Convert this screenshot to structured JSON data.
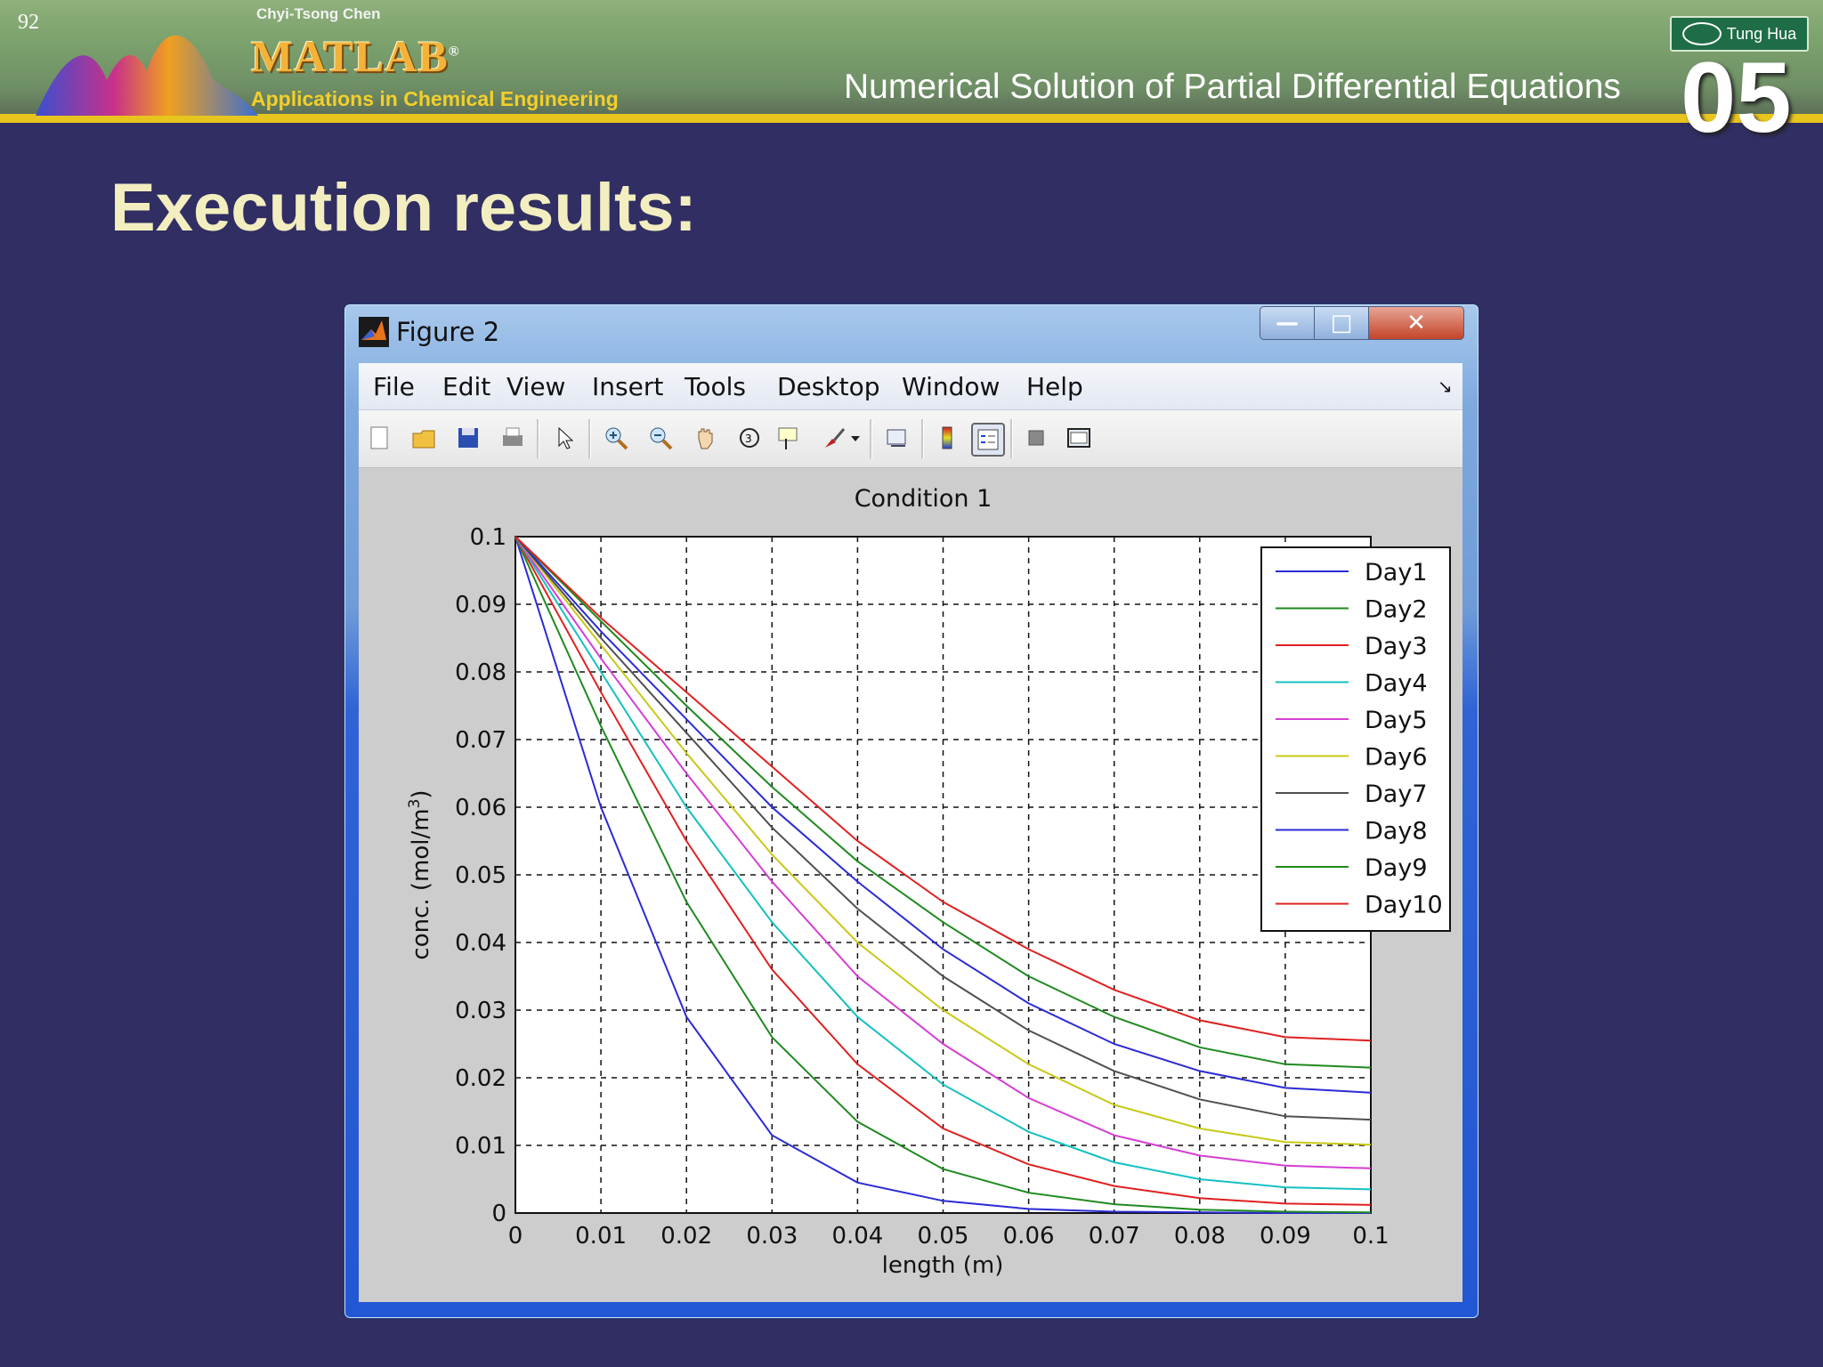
{
  "slide": {
    "number": "92",
    "author": "Chyi-Tsong Chen",
    "brand": "MATLAB",
    "brand_mark": "®",
    "subtitle": "Applications in Chemical Engineering",
    "chapter_title": "Numerical Solution of Partial Differential Equations",
    "publisher": "Tung Hua",
    "chapter_number": "05",
    "heading": "Execution results:",
    "colors": {
      "background": "#302e62",
      "banner": "#7aa06c",
      "stripe": "#e8c51e",
      "heading": "#f2eec0"
    }
  },
  "window": {
    "title": "Figure 2",
    "menu": [
      "File",
      "Edit",
      "View",
      "Insert",
      "Tools",
      "Desktop",
      "Window",
      "Help"
    ],
    "toolbar_icons": [
      "new-figure-icon",
      "open-file-icon",
      "save-icon",
      "print-icon",
      "pointer-icon",
      "zoom-in-icon",
      "zoom-out-icon",
      "pan-hand-icon",
      "rotate-3d-icon",
      "data-cursor-icon",
      "brush-icon",
      "link-plot-icon",
      "colorbar-icon",
      "legend-icon",
      "hide-plot-tools-icon",
      "show-plot-tools-icon"
    ]
  },
  "chart_data": {
    "type": "line",
    "title": "Condition 1",
    "xlabel": "length (m)",
    "ylabel": "conc. (mol/m",
    "ylabel_sup": "3",
    "ylabel_close": ")",
    "xlim": [
      0,
      0.1
    ],
    "ylim": [
      0,
      0.1
    ],
    "x_ticks": [
      "0",
      "0.01",
      "0.02",
      "0.03",
      "0.04",
      "0.05",
      "0.06",
      "0.07",
      "0.08",
      "0.09",
      "0.1"
    ],
    "y_ticks": [
      "0",
      "0.01",
      "0.02",
      "0.03",
      "0.04",
      "0.05",
      "0.06",
      "0.07",
      "0.08",
      "0.09",
      "0.1"
    ],
    "grid": true,
    "legend_position": "top-right",
    "x": [
      0,
      0.01,
      0.02,
      0.03,
      0.04,
      0.05,
      0.06,
      0.07,
      0.08,
      0.09,
      0.1
    ],
    "series": [
      {
        "name": "Day1",
        "color": "#2b2bd6",
        "values": [
          0.1,
          0.06,
          0.029,
          0.0115,
          0.0045,
          0.0018,
          0.0006,
          0.0002,
          0.0001,
          0.0,
          0.0
        ]
      },
      {
        "name": "Day2",
        "color": "#1f8a1f",
        "values": [
          0.1,
          0.072,
          0.046,
          0.026,
          0.0135,
          0.0065,
          0.003,
          0.0013,
          0.0005,
          0.0002,
          0.0001
        ]
      },
      {
        "name": "Day3",
        "color": "#e02020",
        "values": [
          0.1,
          0.077,
          0.055,
          0.036,
          0.022,
          0.0125,
          0.0072,
          0.004,
          0.0022,
          0.0014,
          0.0012
        ]
      },
      {
        "name": "Day4",
        "color": "#14c0c0",
        "values": [
          0.1,
          0.08,
          0.06,
          0.043,
          0.029,
          0.019,
          0.012,
          0.0075,
          0.005,
          0.0038,
          0.0035
        ]
      },
      {
        "name": "Day5",
        "color": "#d43ed4",
        "values": [
          0.1,
          0.082,
          0.065,
          0.049,
          0.035,
          0.025,
          0.017,
          0.0115,
          0.0085,
          0.007,
          0.0066
        ]
      },
      {
        "name": "Day6",
        "color": "#c8c818",
        "values": [
          0.1,
          0.084,
          0.068,
          0.053,
          0.04,
          0.03,
          0.022,
          0.016,
          0.0125,
          0.0105,
          0.0101
        ]
      },
      {
        "name": "Day7",
        "color": "#505050",
        "values": [
          0.1,
          0.085,
          0.071,
          0.057,
          0.045,
          0.035,
          0.027,
          0.021,
          0.0168,
          0.0143,
          0.0138
        ]
      },
      {
        "name": "Day8",
        "color": "#2b2bd6",
        "values": [
          0.1,
          0.086,
          0.073,
          0.06,
          0.049,
          0.039,
          0.031,
          0.025,
          0.021,
          0.0185,
          0.0178
        ]
      },
      {
        "name": "Day9",
        "color": "#1f8a1f",
        "values": [
          0.1,
          0.0875,
          0.075,
          0.063,
          0.052,
          0.043,
          0.035,
          0.029,
          0.0245,
          0.022,
          0.0215
        ]
      },
      {
        "name": "Day10",
        "color": "#e02020",
        "values": [
          0.1,
          0.088,
          0.077,
          0.066,
          0.055,
          0.046,
          0.039,
          0.033,
          0.0285,
          0.026,
          0.0255
        ]
      }
    ]
  }
}
